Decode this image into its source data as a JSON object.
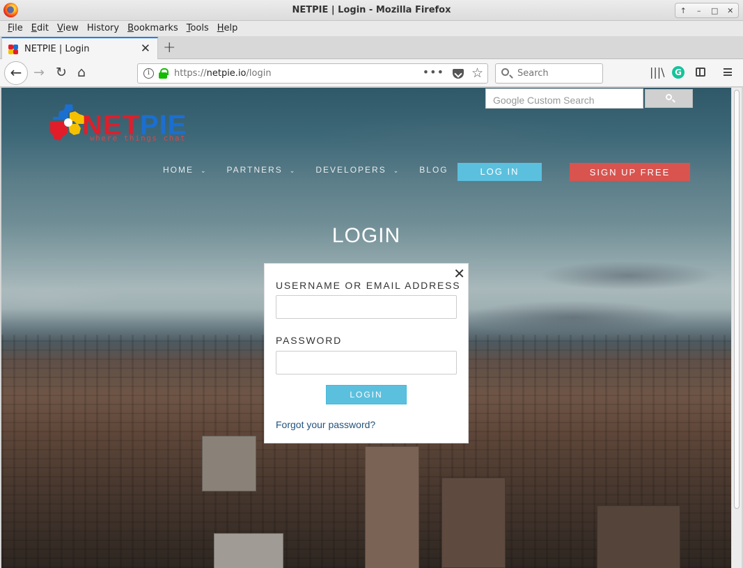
{
  "window": {
    "title": "NETPIE | Login - Mozilla Firefox",
    "controls": [
      "↑",
      "–",
      "□",
      "✕"
    ]
  },
  "menu": {
    "items": [
      {
        "label": "File",
        "accel": "F",
        "rest": "ile"
      },
      {
        "label": "Edit",
        "accel": "E",
        "rest": "dit"
      },
      {
        "label": "View",
        "accel": "V",
        "rest": "iew"
      },
      {
        "label": "History",
        "accel": "",
        "rest": "History"
      },
      {
        "label": "Bookmarks",
        "accel": "B",
        "rest": "ookmarks"
      },
      {
        "label": "Tools",
        "accel": "T",
        "rest": "ools"
      },
      {
        "label": "Help",
        "accel": "H",
        "rest": "elp"
      }
    ]
  },
  "tab": {
    "label": "NETPIE | Login",
    "close": "✕",
    "new_tab": "+"
  },
  "nav": {
    "back": "←",
    "forward": "→",
    "reload": "↻",
    "home": "⌂",
    "url_prefix": "https://",
    "url_host": "netpie.io",
    "url_path": "/login",
    "page_actions": "•••",
    "star": "☆",
    "search_placeholder": "Search",
    "library": "|||\\"
  },
  "site": {
    "google_search_placeholder": "Google Custom Search",
    "logo": {
      "net": "NET",
      "pie": "PIE",
      "tagline": "where things chat"
    },
    "nav_items": [
      {
        "label": "HOME",
        "caret": "⌄"
      },
      {
        "label": "PARTNERS",
        "caret": "⌄"
      },
      {
        "label": "DEVELOPERS",
        "caret": "⌄"
      },
      {
        "label": "BLOG",
        "caret": ""
      }
    ],
    "login_button": "LOG IN",
    "signup_button": "SIGN UP FREE",
    "page_title": "LOGIN"
  },
  "modal": {
    "close": "✕",
    "username_label": "USERNAME OR EMAIL ADDRESS",
    "username_value": "",
    "password_label": "PASSWORD",
    "password_value": "",
    "submit_label": "LOGIN",
    "forgot_link": "Forgot your password?"
  },
  "colors": {
    "accent_blue": "#5bc0de",
    "signup_red": "#d9534f",
    "logo_red": "#e11d2a",
    "logo_blue": "#1b6fd1",
    "logo_yellow": "#f5c000",
    "link": "#23527c",
    "tab_highlight": "#0a84ff",
    "lock_green": "#12bc00"
  }
}
